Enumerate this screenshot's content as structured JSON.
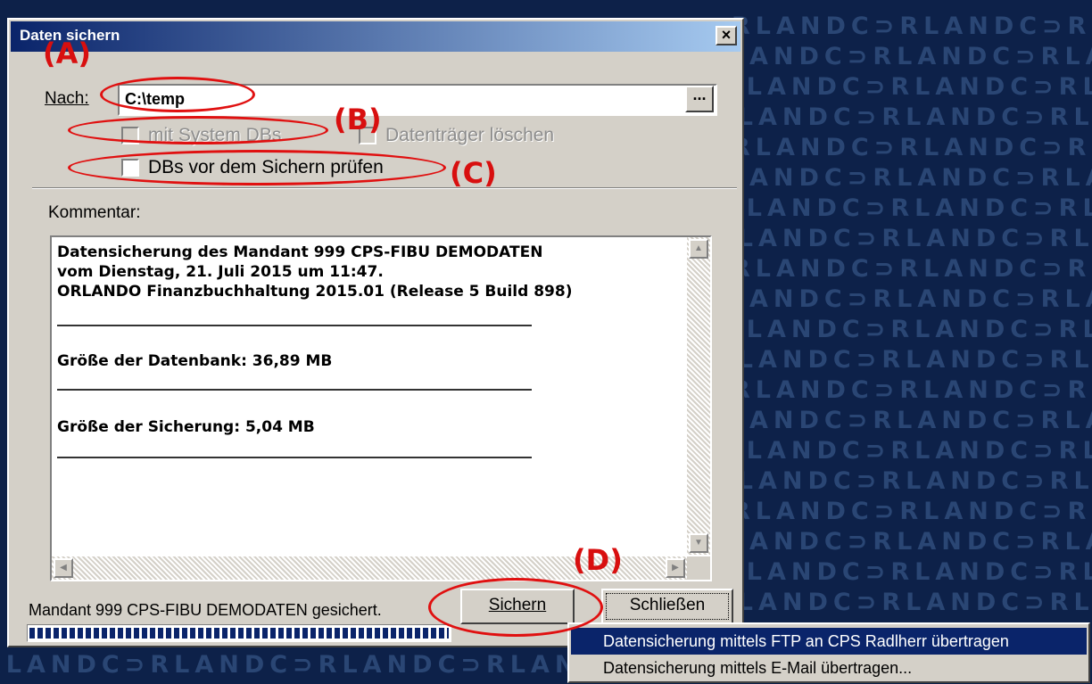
{
  "wallpaper": {
    "brand_text": "RLANDC⊃RLANDC⊃RLANDC⊃RLANDC⊃RLANDC⊃RLANDC⊃"
  },
  "dialog": {
    "title": "Daten sichern",
    "close_symbol": "×",
    "target": {
      "label": "Nach:",
      "value": "C:\\temp",
      "browse_label": "..."
    },
    "options": {
      "system_dbs": {
        "label": "mit System DBs",
        "checked": false,
        "enabled": false
      },
      "erase_media": {
        "label": "Datenträger löschen",
        "checked": false,
        "enabled": false
      },
      "check_dbs": {
        "label": "DBs vor dem Sichern prüfen",
        "checked": false,
        "enabled": true
      }
    },
    "comment": {
      "label": "Kommentar:",
      "lines": [
        "Datensicherung des Mandant 999 CPS-FIBU DEMODATEN",
        "vom Dienstag, 21. Juli 2015 um 11:47.",
        "ORLANDO Finanzbuchhaltung 2015.01 (Release 5 Build 898)"
      ],
      "db_size": "Größe der Datenbank: 36,89 MB",
      "backup_size": "Größe der Sicherung: 5,04 MB"
    },
    "status": {
      "text": "Mandant 999 CPS-FIBU DEMODATEN gesichert.",
      "progress": 1.0
    },
    "buttons": {
      "save": "Sichern",
      "close": "Schließen"
    }
  },
  "context_menu": {
    "items": [
      {
        "label": "Datensicherung mittels FTP an CPS Radlherr übertragen",
        "highlighted": true
      },
      {
        "label": "Datensicherung mittels E-Mail übertragen...",
        "highlighted": false
      }
    ]
  },
  "annotations": [
    "(A)",
    "(B)",
    "(C)",
    "(D)"
  ],
  "colors": {
    "annotation": "#e01010",
    "title_bar": "#0a246a",
    "wallpaper": "#0d2149",
    "dialog_face": "#d4d0c8"
  }
}
